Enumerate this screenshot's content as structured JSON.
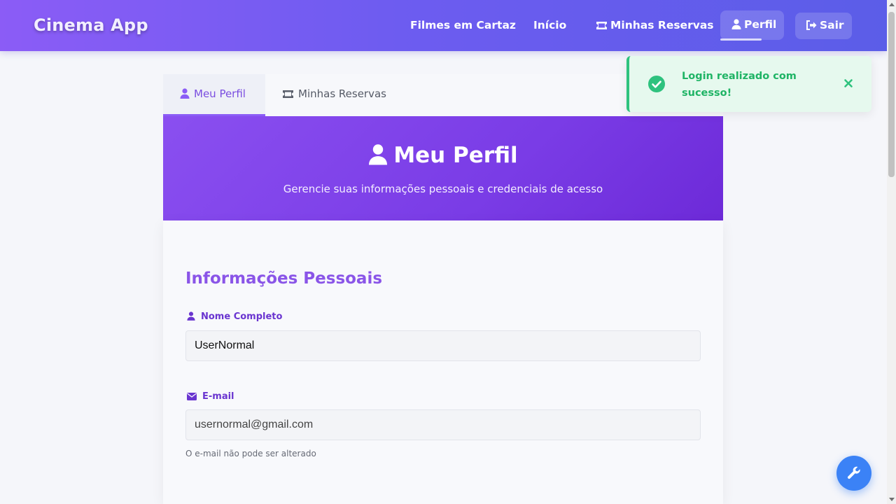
{
  "header": {
    "brand": "Cinema App",
    "nav": {
      "movies": "Filmes em Cartaz",
      "home": "Início",
      "reservations": "Minhas Reservas",
      "profile": "Perfil",
      "logout": "Sair"
    },
    "active_item": "Perfil"
  },
  "tabs": {
    "profile": "Meu Perfil",
    "reservations": "Minhas Reservas",
    "active": "Meu Perfil"
  },
  "hero": {
    "title": "Meu Perfil",
    "subtitle": "Gerencie suas informações pessoais e credenciais de acesso"
  },
  "personal_info": {
    "section_title": "Informações Pessoais",
    "name_label": "Nome Completo",
    "name_value": "UserNormal",
    "email_label": "E-mail",
    "email_value": "usernormal@gmail.com",
    "email_hint": "O e-mail não pode ser alterado"
  },
  "toast": {
    "message": "Login realizado com sucesso!",
    "icon": "check-circle-icon",
    "close_icon": "close-icon",
    "color": "#1fb465"
  },
  "fab": {
    "icon": "wrench-icon",
    "color": "#3b82f6"
  },
  "icons": {
    "reservations_nav": "ticket-icon",
    "profile_nav": "user-icon",
    "logout_nav": "sign-out-icon",
    "name_field": "user-icon",
    "email_field": "envelope-icon"
  },
  "colors": {
    "header_gradient_start": "#8b5cf6",
    "header_gradient_end": "#5b5de8",
    "accent": "#8a55e8",
    "hero_gradient_start": "#8a4ff0",
    "hero_gradient_end": "#6d2ad8"
  }
}
